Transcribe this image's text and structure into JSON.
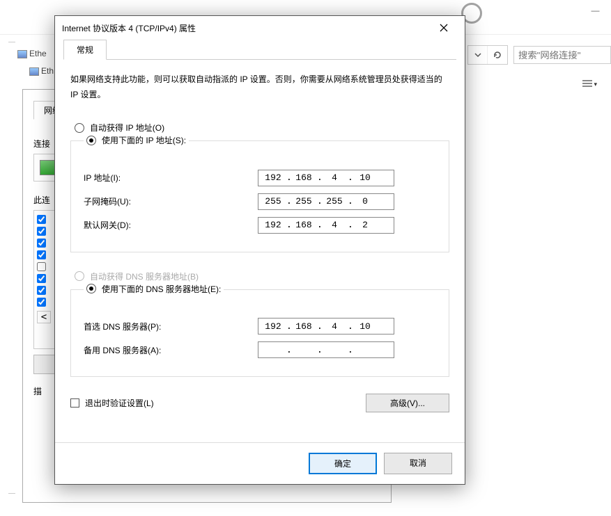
{
  "bgWindow": {
    "search_placeholder": "搜索\"网络连接\"",
    "ethTab1": "Ethe",
    "ethTab2": "Eth"
  },
  "underDialog": {
    "tab": "网络",
    "connect_label": "连接",
    "items_label": "此连",
    "desc_label": "描"
  },
  "dialog": {
    "title": "Internet 协议版本 4 (TCP/IPv4) 属性",
    "tab_label": "常规",
    "description": "如果网络支持此功能，则可以获取自动指派的 IP 设置。否则，你需要从网络系统管理员处获得适当的 IP 设置。",
    "ip_section": {
      "auto_label": "自动获得 IP 地址(O)",
      "manual_label": "使用下面的 IP 地址(S):",
      "selected": "manual",
      "fields": {
        "ip": {
          "label": "IP 地址(I):",
          "octets": [
            "192",
            "168",
            "4",
            "10"
          ]
        },
        "mask": {
          "label": "子网掩码(U):",
          "octets": [
            "255",
            "255",
            "255",
            "0"
          ]
        },
        "gateway": {
          "label": "默认网关(D):",
          "octets": [
            "192",
            "168",
            "4",
            "2"
          ]
        }
      }
    },
    "dns_section": {
      "auto_label": "自动获得 DNS 服务器地址(B)",
      "manual_label": "使用下面的 DNS 服务器地址(E):",
      "selected": "manual",
      "auto_disabled": true,
      "fields": {
        "primary": {
          "label": "首选 DNS 服务器(P):",
          "octets": [
            "192",
            "168",
            "4",
            "10"
          ]
        },
        "alternate": {
          "label": "备用 DNS 服务器(A):",
          "octets": [
            "",
            "",
            "",
            ""
          ]
        }
      }
    },
    "validate_label": "退出时验证设置(L)",
    "advanced_label": "高级(V)...",
    "ok_label": "确定",
    "cancel_label": "取消"
  }
}
